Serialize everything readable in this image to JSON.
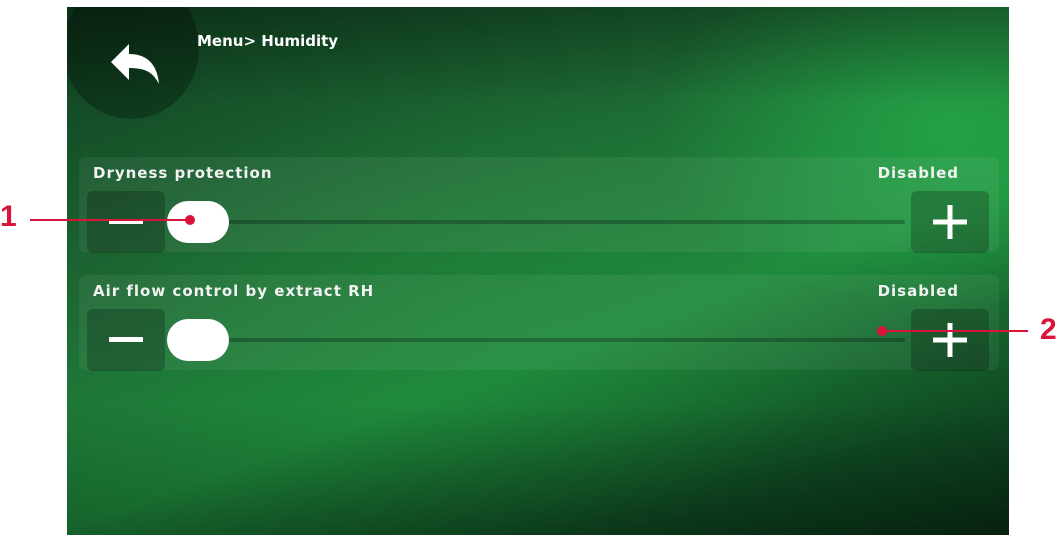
{
  "header": {
    "breadcrumb": "Menu> Humidity",
    "back_icon": "back-arrow-icon"
  },
  "settings": [
    {
      "label": "Dryness protection",
      "status": "Disabled",
      "minus_icon": "minus-icon",
      "plus_icon": "plus-icon",
      "slider_level": 0
    },
    {
      "label": "Air flow control by extract RH",
      "status": "Disabled",
      "minus_icon": "minus-icon",
      "plus_icon": "plus-icon",
      "slider_level": 0
    }
  ],
  "callouts": [
    {
      "number": "1"
    },
    {
      "number": "2"
    }
  ],
  "colors": {
    "callout": "#d8143a",
    "screen_green": "#1f8a3d",
    "thumb": "#ffffff"
  }
}
